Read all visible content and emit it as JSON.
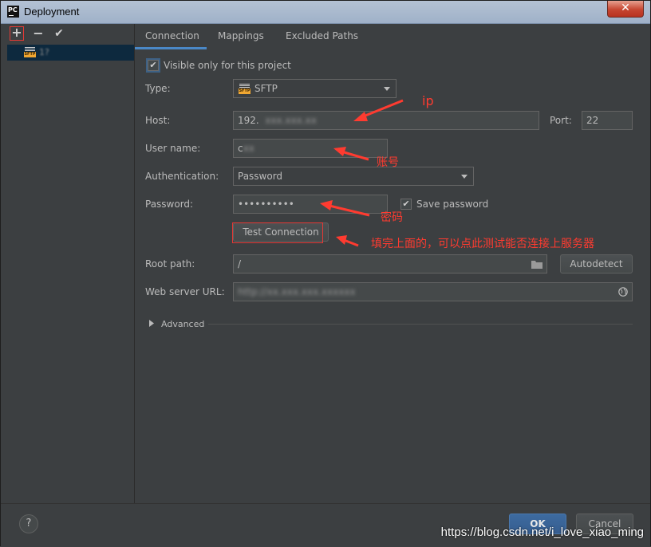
{
  "window": {
    "title": "Deployment",
    "logo_text": "PC",
    "close_glyph": "✕"
  },
  "left_toolbar": {
    "add_glyph": "+",
    "remove_glyph": "−",
    "apply_glyph": "✔"
  },
  "servers": [
    {
      "name": "1?",
      "type_tag": "SFTP",
      "selected": true
    }
  ],
  "tabs": [
    {
      "label": "Connection",
      "active": true
    },
    {
      "label": "Mappings",
      "active": false
    },
    {
      "label": "Excluded Paths",
      "active": false
    }
  ],
  "connection": {
    "visible_only_label": "Visible only for this project",
    "visible_only_checked": true,
    "type_label": "Type:",
    "type_value": "SFTP",
    "host_label": "Host:",
    "host_value": "192.",
    "port_label": "Port:",
    "port_value": "22",
    "user_label": "User name:",
    "user_value": "c",
    "auth_label": "Authentication:",
    "auth_value": "Password",
    "password_label": "Password:",
    "password_value": "••••••••••",
    "save_password_label": "Save password",
    "save_password_checked": true,
    "test_button": "Test Connection",
    "root_label": "Root path:",
    "root_value": "/",
    "autodetect_button": "Autodetect",
    "web_url_label": "Web server URL:",
    "web_url_value": "http://",
    "advanced_label": "Advanced"
  },
  "annotations": {
    "ip": "ip",
    "account": "账号",
    "password": "密码",
    "test_hint": "填完上面的，可以点此测试能否连接上服务器"
  },
  "footer": {
    "help_glyph": "?",
    "ok_button": "OK",
    "cancel_button": "Cancel"
  },
  "watermark": "https://blog.csdn.net/i_love_xiao_ming",
  "colors": {
    "background": "#3c3f41",
    "accent": "#4a88c7",
    "annotation": "#ff3b30",
    "selection": "#0d293e"
  }
}
